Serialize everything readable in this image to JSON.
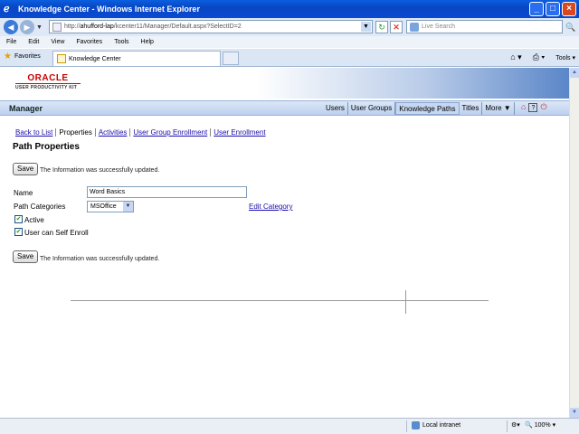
{
  "window": {
    "title": "Knowledge Center - Windows Internet Explorer",
    "minimize": "_",
    "maximize": "□",
    "close": "×"
  },
  "address": {
    "url_prefix": "http://",
    "url_host": "ahufford-lap",
    "url_path": "/kcenter11/Manager/Default.aspx?SelectID=2",
    "search_placeholder": "Live Search"
  },
  "menu": [
    "File",
    "Edit",
    "View",
    "Favorites",
    "Tools",
    "Help"
  ],
  "favorites": {
    "label": "Favorites",
    "tab_title": "Knowledge Center",
    "page_label": "",
    "tools_label": "Tools"
  },
  "banner": {
    "brand": "ORACLE",
    "product": "USER PRODUCTIVITY KIT"
  },
  "nav": {
    "section": "Manager",
    "links": [
      "Users",
      "User Groups",
      "Knowledge Paths",
      "Titles",
      "More ▼"
    ],
    "active": "Knowledge Paths"
  },
  "subnav": {
    "back": "Back to List",
    "properties": "Properties",
    "activities": "Activities",
    "group_enrollment": "User Group Enrollment",
    "user_enrollment": "User Enrollment"
  },
  "page": {
    "heading": "Path Properties",
    "save_label": "Save",
    "message": "The Information was successfully updated.",
    "name_label": "Name",
    "name_value": "Word Basics",
    "category_label": "Path Categories",
    "category_value": "MSOffice",
    "edit_category": "Edit Category",
    "active_label": "Active",
    "self_enroll_label": "User can Self Enroll"
  },
  "status": {
    "zone": "Local intranet",
    "zoom": "100%"
  }
}
